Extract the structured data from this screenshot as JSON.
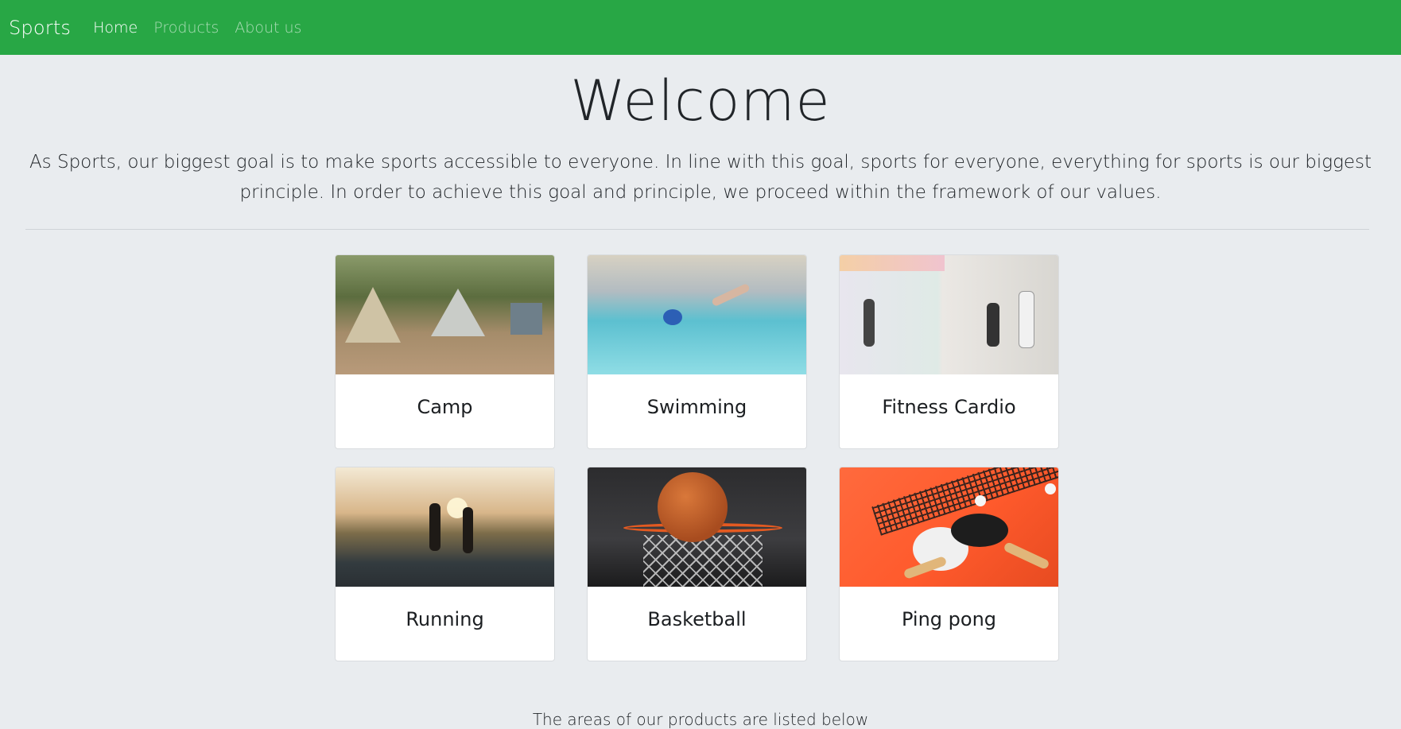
{
  "navbar": {
    "brand": "Sports",
    "links": [
      {
        "label": "Home",
        "active": true
      },
      {
        "label": "Products",
        "active": false
      },
      {
        "label": "About us",
        "active": false
      }
    ],
    "background": "#28a745"
  },
  "hero": {
    "title": "Welcome",
    "lead": "As Sports, our biggest goal is to make sports accessible to everyone. In line with this goal, sports for everyone, everything for sports is our biggest principle. In order to achieve this goal and principle, we proceed within the framework of our values."
  },
  "categories": [
    {
      "title": "Camp",
      "image": "camping-photo"
    },
    {
      "title": "Swimming",
      "image": "swimming-photo"
    },
    {
      "title": "Fitness Cardio",
      "image": "fitness-photo"
    },
    {
      "title": "Running",
      "image": "running-photo"
    },
    {
      "title": "Basketball",
      "image": "basketball-photo"
    },
    {
      "title": "Ping pong",
      "image": "ping-pong-photo"
    }
  ],
  "footer": {
    "text": "The areas of our products are listed below"
  }
}
